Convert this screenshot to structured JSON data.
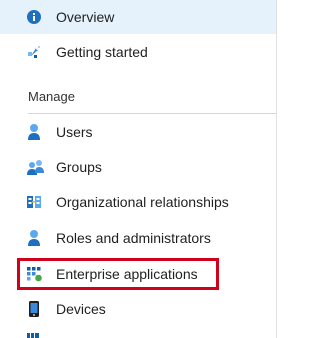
{
  "nav": {
    "items": [
      {
        "label": "Overview",
        "icon": "info-icon",
        "selected": true
      },
      {
        "label": "Getting started",
        "icon": "rocket-icon",
        "selected": false
      }
    ],
    "section": {
      "title": "Manage",
      "items": [
        {
          "label": "Users",
          "icon": "user-icon"
        },
        {
          "label": "Groups",
          "icon": "groups-icon"
        },
        {
          "label": "Organizational relationships",
          "icon": "organization-icon"
        },
        {
          "label": "Roles and administrators",
          "icon": "roles-icon"
        },
        {
          "label": "Enterprise applications",
          "icon": "apps-icon",
          "highlighted": true
        },
        {
          "label": "Devices",
          "icon": "device-icon"
        }
      ]
    }
  },
  "colors": {
    "selected_background": "#e6f2fb",
    "highlight_border": "#d0021b",
    "azure_blue": "#0f5ea5"
  }
}
